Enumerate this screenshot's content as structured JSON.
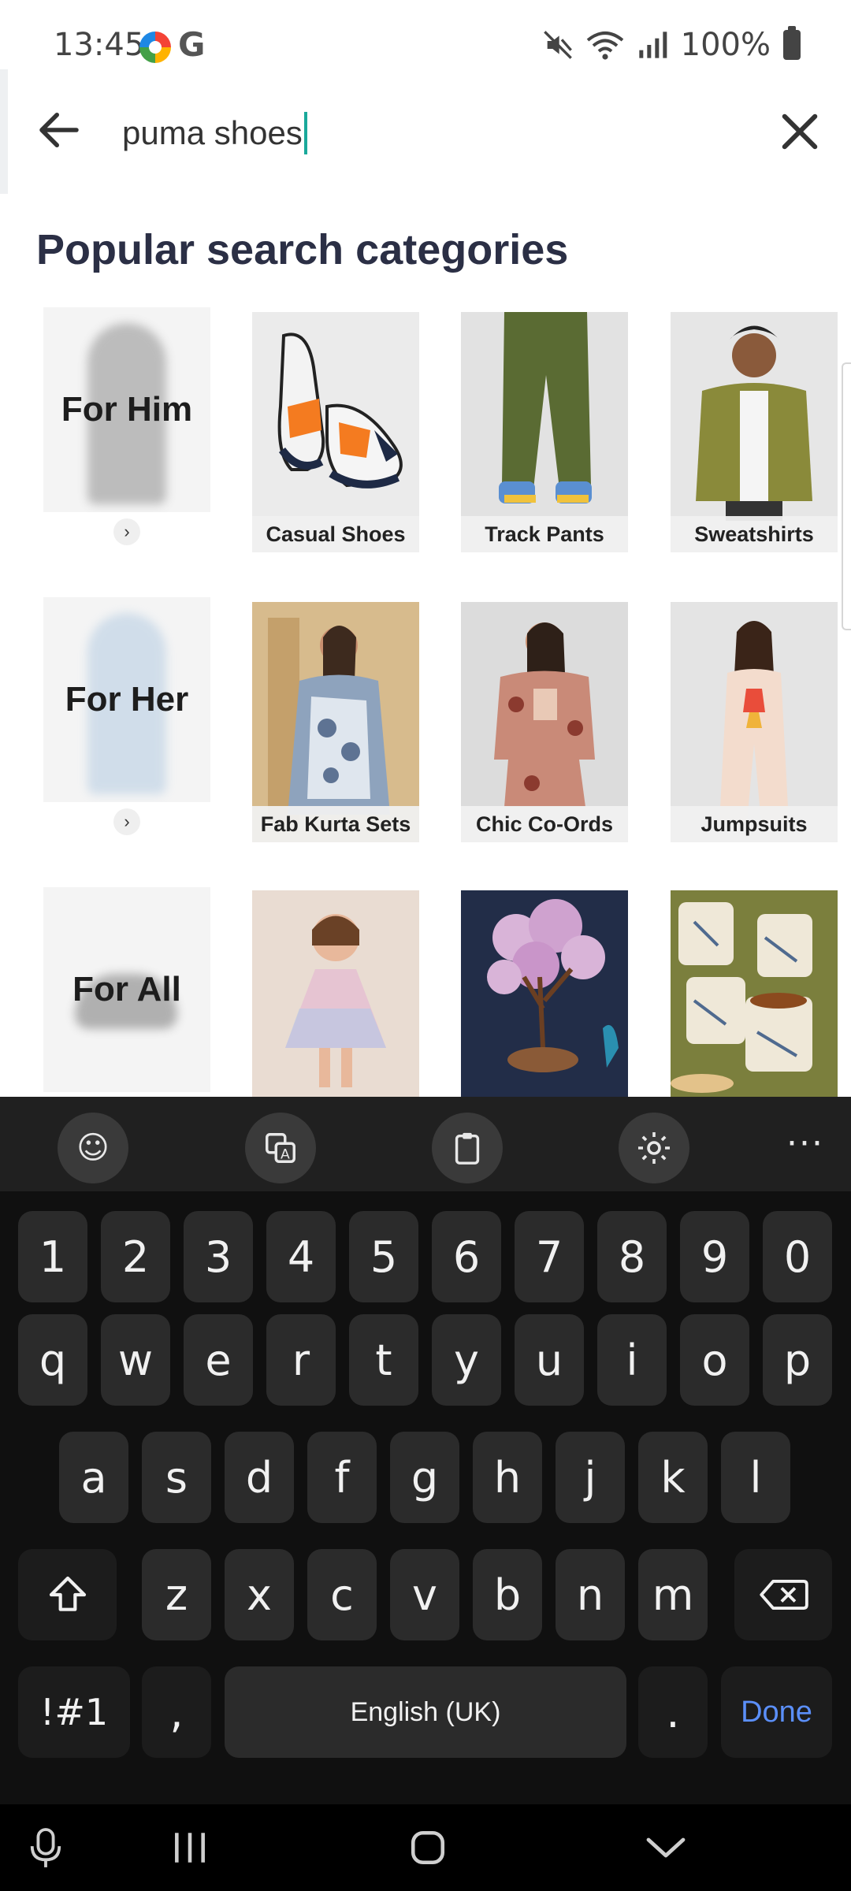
{
  "status_bar": {
    "time": "13:45",
    "battery": "100%"
  },
  "search": {
    "query": "puma shoes"
  },
  "section": {
    "title": "Popular search categories"
  },
  "categories": {
    "row1": [
      {
        "label": "For Him",
        "kind": "gender"
      },
      {
        "label": "Casual Shoes",
        "kind": "product"
      },
      {
        "label": "Track Pants",
        "kind": "product"
      },
      {
        "label": "Sweatshirts",
        "kind": "product"
      }
    ],
    "row2": [
      {
        "label": "For Her",
        "kind": "gender"
      },
      {
        "label": "Fab Kurta Sets",
        "kind": "product"
      },
      {
        "label": "Chic Co-Ords",
        "kind": "product"
      },
      {
        "label": "Jumpsuits",
        "kind": "product"
      }
    ],
    "row3": [
      {
        "label": "For All",
        "kind": "gender"
      },
      {
        "label": "",
        "kind": "product"
      },
      {
        "label": "",
        "kind": "product"
      },
      {
        "label": "",
        "kind": "product"
      }
    ]
  },
  "keyboard": {
    "number_row": [
      "1",
      "2",
      "3",
      "4",
      "5",
      "6",
      "7",
      "8",
      "9",
      "0"
    ],
    "row_q": [
      "q",
      "w",
      "e",
      "r",
      "t",
      "y",
      "u",
      "i",
      "o",
      "p"
    ],
    "row_a": [
      "a",
      "s",
      "d",
      "f",
      "g",
      "h",
      "j",
      "k",
      "l"
    ],
    "row_z": [
      "z",
      "x",
      "c",
      "v",
      "b",
      "n",
      "m"
    ],
    "symbols": "!#1",
    "comma": ",",
    "space": "English (UK)",
    "period": ".",
    "done": "Done",
    "more": "···"
  },
  "colors": {
    "accent_caret": "#1aa99b",
    "done_text": "#5b8ff9",
    "title_text": "#2b2f45"
  }
}
